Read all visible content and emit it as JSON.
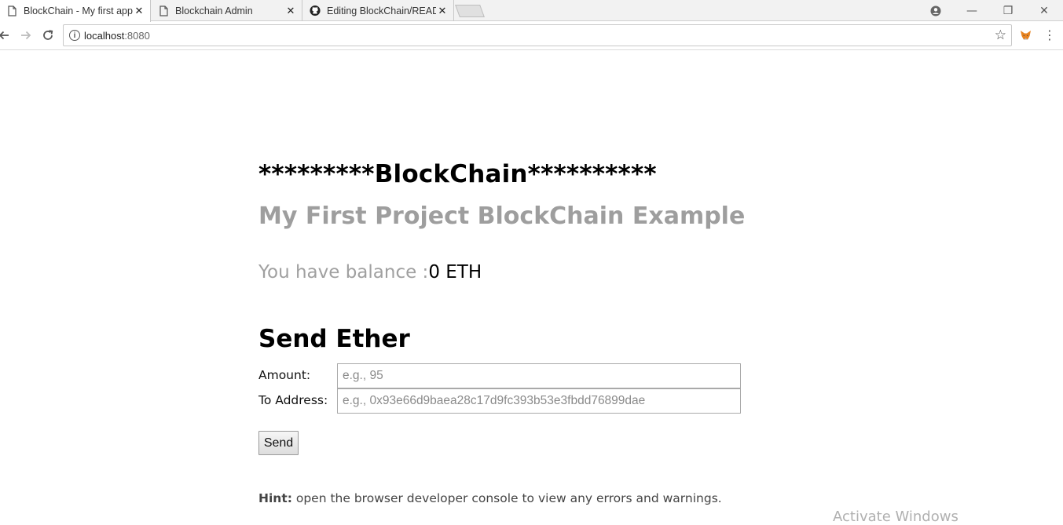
{
  "browser": {
    "tabs": [
      {
        "title": "BlockChain - My first app",
        "active": true,
        "icon": "page-icon"
      },
      {
        "title": "Blockchain Admin",
        "active": false,
        "icon": "page-icon"
      },
      {
        "title": "Editing BlockChain/READ",
        "active": false,
        "icon": "github-icon"
      }
    ],
    "close_glyph": "✕",
    "address": {
      "host": "localhost",
      "port": ":8080"
    },
    "window_controls": {
      "minimize": "—",
      "restore": "❐",
      "close": "✕"
    }
  },
  "page": {
    "heading": "*********BlockChain**********",
    "subheading": "My First Project BlockChain Example",
    "balance_label": "You have balance :",
    "balance_value": "0 ETH",
    "send_title": "Send Ether",
    "amount_label": "Amount:",
    "amount_placeholder": "e.g., 95",
    "address_label": "To Address:",
    "address_placeholder": "e.g., 0x93e66d9baea28c17d9fc393b53e3fbdd76899dae",
    "send_button": "Send",
    "hint_label": "Hint:",
    "hint_text": " open the browser developer console to view any errors and warnings."
  },
  "os": {
    "watermark": "Activate Windows"
  }
}
